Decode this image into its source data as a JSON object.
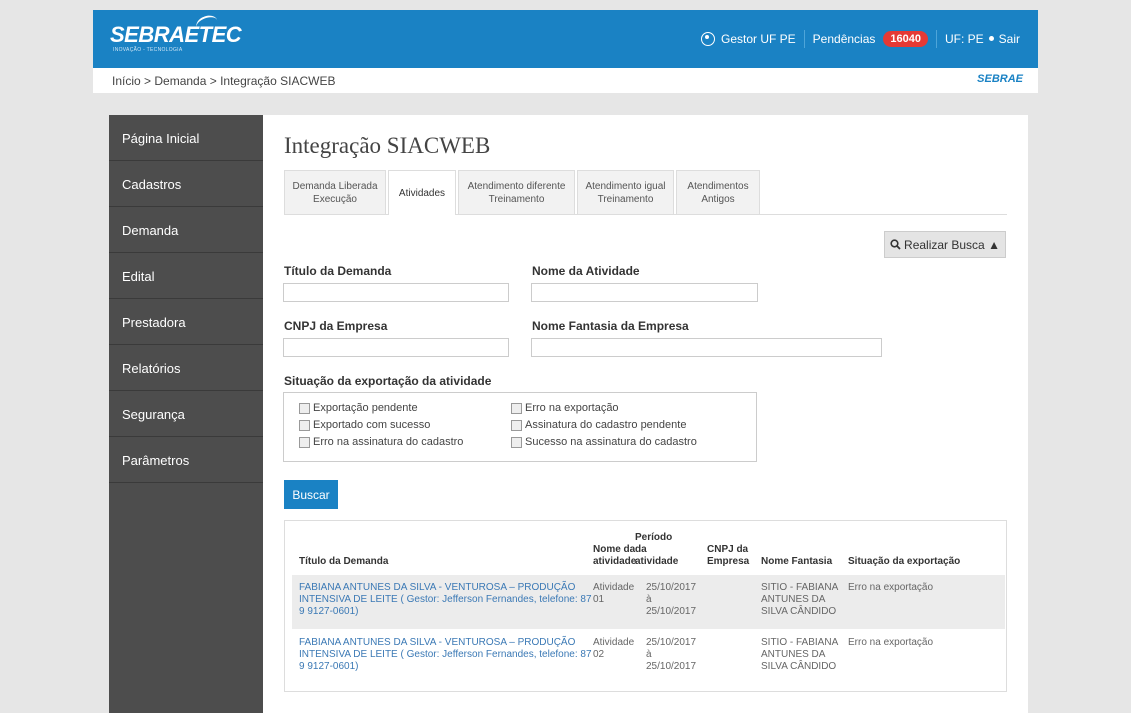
{
  "header": {
    "logo_text": "SEBRAETEC",
    "logo_sub": "INOVAÇÃO - TECNOLOGIA",
    "user": "Gestor UF PE",
    "pending_label": "Pendências",
    "pending_count": "16040",
    "uf": "UF: PE",
    "logout": "Sair",
    "accent_color": "#1a82c4"
  },
  "breadcrumb": "Início > Demanda > Integração SIACWEB",
  "brand_logo": "SEBRAE",
  "sidebar": {
    "items": [
      {
        "label": "Página Inicial"
      },
      {
        "label": "Cadastros"
      },
      {
        "label": "Demanda"
      },
      {
        "label": "Edital"
      },
      {
        "label": "Prestadora"
      },
      {
        "label": "Relatórios"
      },
      {
        "label": "Segurança"
      },
      {
        "label": "Parâmetros"
      }
    ]
  },
  "page": {
    "title": "Integração SIACWEB",
    "tabs": [
      {
        "line1": "Demanda Liberada",
        "line2": "Execução"
      },
      {
        "line1": "Atividades",
        "line2": ""
      },
      {
        "line1": "Atendimento diferente",
        "line2": "Treinamento"
      },
      {
        "line1": "Atendimento igual",
        "line2": "Treinamento"
      },
      {
        "line1": "Atendimentos",
        "line2": "Antigos"
      }
    ],
    "active_tab": "Atividades",
    "search_toggle": "Realizar Busca ▲"
  },
  "form": {
    "titulo_label": "Título da Demanda",
    "titulo_value": "",
    "atividade_label": "Nome da Atividade",
    "atividade_value": "",
    "cnpj_label": "CNPJ da Empresa",
    "cnpj_value": "",
    "fantasia_label": "Nome Fantasia da Empresa",
    "fantasia_value": "",
    "situacao_label": "Situação da exportação da atividade",
    "checkboxes": [
      "Exportação pendente",
      "Erro na exportação",
      "Exportado com sucesso",
      "Assinatura do cadastro pendente",
      "Erro na assinatura do cadastro",
      "Sucesso na assinatura do cadastro"
    ],
    "submit": "Buscar"
  },
  "table": {
    "headers": {
      "titulo": "Título da Demanda",
      "nome1": "Nome da",
      "nome2": "atividade",
      "periodo1": "Período",
      "periodo2": "da",
      "periodo3": "atividade",
      "cnpj1": "CNPJ da",
      "cnpj2": "Empresa",
      "fantasia": "Nome Fantasia",
      "situacao": "Situação da exportação"
    },
    "rows": [
      {
        "titulo1": "FABIANA ANTUNES DA SILVA - VENTUROSA – PRODUÇÃO",
        "titulo2": "INTENSIVA DE LEITE ( Gestor: Jefferson Fernandes, telefone: 87",
        "titulo3": "9 9127-0601)",
        "atividade1": "Atividade",
        "atividade2": "01",
        "periodo1": "25/10/2017",
        "periodo2": "à",
        "periodo3": "25/10/2017",
        "cnpj": "",
        "fantasia1": "SITIO - FABIANA",
        "fantasia2": "ANTUNES DA",
        "fantasia3": "SILVA CÂNDIDO",
        "situacao": "Erro na exportação"
      },
      {
        "titulo1": "FABIANA ANTUNES DA SILVA - VENTUROSA – PRODUÇÃO",
        "titulo2": "INTENSIVA DE LEITE ( Gestor: Jefferson Fernandes, telefone: 87",
        "titulo3": "9 9127-0601)",
        "atividade1": "Atividade",
        "atividade2": "02",
        "periodo1": "25/10/2017",
        "periodo2": "à",
        "periodo3": "25/10/2017",
        "cnpj": "",
        "fantasia1": "SITIO - FABIANA",
        "fantasia2": "ANTUNES DA",
        "fantasia3": "SILVA CÂNDIDO",
        "situacao": "Erro na exportação"
      }
    ]
  }
}
